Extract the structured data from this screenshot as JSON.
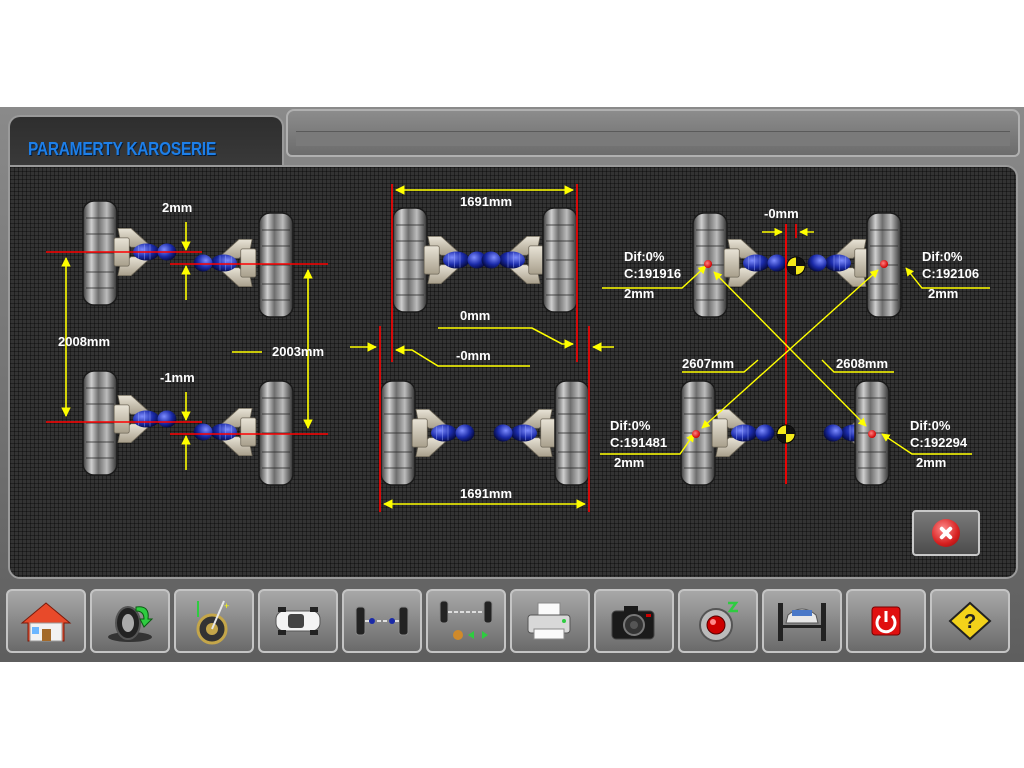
{
  "header": {
    "title": "PARAMERTY KAROSERIE"
  },
  "measurements": {
    "panel1": {
      "front_offset": "2mm",
      "rear_offset": "-1mm",
      "left_wheelbase": "2008mm",
      "right_wheelbase": "2003mm"
    },
    "panel2": {
      "front_track": "1691mm",
      "rear_track": "1691mm",
      "lateral_offset_top": "0mm",
      "lateral_offset_bottom": "-0mm"
    },
    "panel3": {
      "center_offset": "-0mm",
      "front_left": {
        "dif": "Dif:0%",
        "c": "C:191916",
        "mm": "2mm"
      },
      "front_right": {
        "dif": "Dif:0%",
        "c": "C:192106",
        "mm": "2mm"
      },
      "rear_left": {
        "dif": "Dif:0%",
        "c": "C:191481",
        "mm": "2mm"
      },
      "rear_right": {
        "dif": "Dif:0%",
        "c": "C:192294",
        "mm": "2mm"
      },
      "diagonal_left": "2607mm",
      "diagonal_right": "2608mm"
    }
  },
  "colors": {
    "title": "#1e7fe8",
    "dimension_line": "#ffff00",
    "reference_line": "#ff0000",
    "spring": "#1a2aa8"
  },
  "toolbar": {
    "icons": [
      "home-icon",
      "wheel-arrow-icon",
      "caster-gauge-icon",
      "car-top-icon",
      "axle-icon",
      "axle-adjust-icon",
      "printer-icon",
      "camera-icon",
      "sensor-icon",
      "car-lift-icon",
      "power-icon",
      "help-icon"
    ]
  }
}
